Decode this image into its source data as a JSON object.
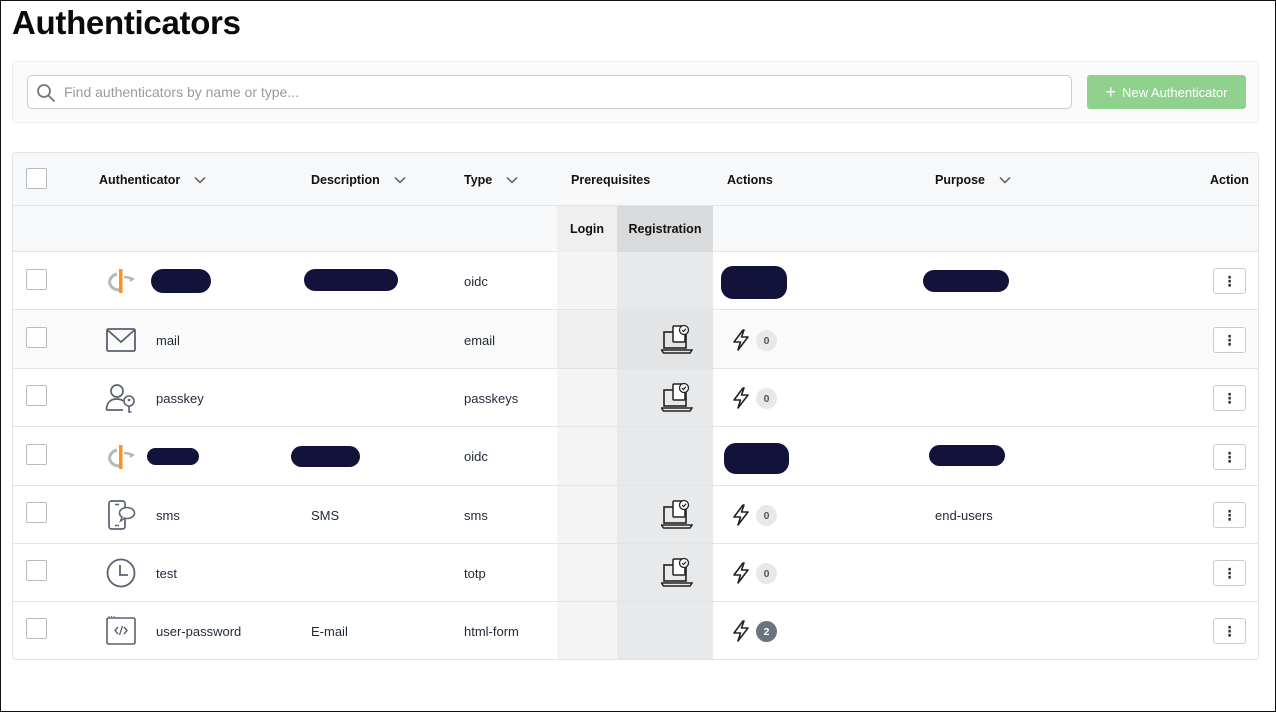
{
  "page": {
    "title": "Authenticators"
  },
  "search": {
    "placeholder": "Find authenticators by name or type..."
  },
  "toolbar": {
    "new_label": "New Authenticator"
  },
  "table": {
    "headers": {
      "authenticator": "Authenticator",
      "description": "Description",
      "type": "Type",
      "prerequisites": "Prerequisites",
      "actions": "Actions",
      "purpose": "Purpose",
      "action": "Action",
      "login": "Login",
      "registration": "Registration"
    },
    "rows": [
      {
        "name": "",
        "description": "",
        "type": "oidc",
        "icon": "openid-icon",
        "redacted": true,
        "count": "",
        "purpose": ""
      },
      {
        "name": "mail",
        "description": "",
        "type": "email",
        "icon": "envelope-icon",
        "count": "0",
        "purpose": ""
      },
      {
        "name": "passkey",
        "description": "",
        "type": "passkeys",
        "icon": "user-key-icon",
        "count": "0",
        "purpose": ""
      },
      {
        "name": "",
        "description": "",
        "type": "oidc",
        "icon": "openid-icon",
        "redacted": true,
        "count": "",
        "purpose": ""
      },
      {
        "name": "sms",
        "description": "SMS",
        "type": "sms",
        "icon": "phone-chat-icon",
        "count": "0",
        "purpose": "end-users"
      },
      {
        "name": "test",
        "description": "",
        "type": "totp",
        "icon": "clock-icon",
        "count": "0",
        "purpose": ""
      },
      {
        "name": "user-password",
        "description": "E-mail",
        "type": "html-form",
        "icon": "code-window-icon",
        "count": "2",
        "purpose": ""
      }
    ],
    "kebab_label": "⋮"
  },
  "colors": {
    "accent": "#8fd18d",
    "redaction": "#12123a",
    "openid_orange": "#f7931e"
  }
}
